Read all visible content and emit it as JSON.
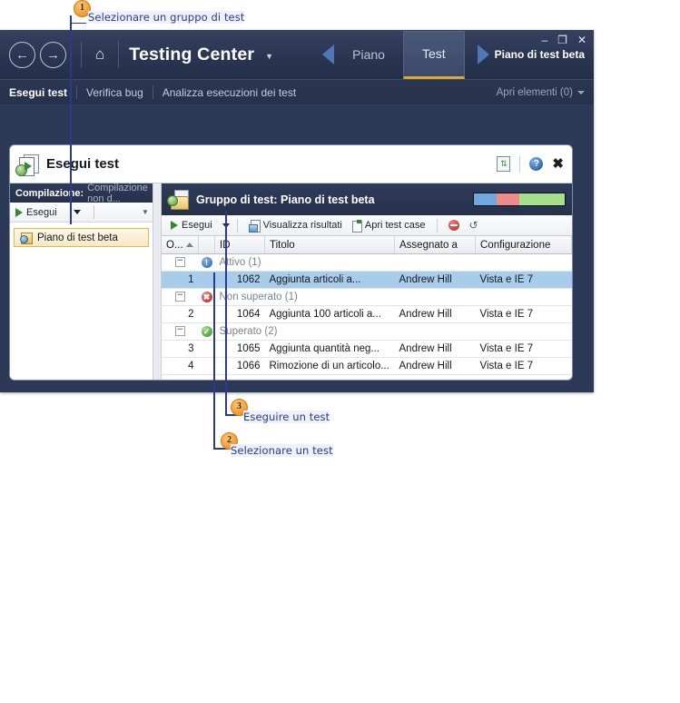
{
  "annotations": [
    {
      "num": "1",
      "text": "Selezionare un gruppo di test"
    },
    {
      "num": "2",
      "text": "Selezionare un test"
    },
    {
      "num": "3",
      "text": "Eseguire un test"
    }
  ],
  "titlebar": {
    "back_icon": "back-arrow-icon",
    "forward_icon": "forward-arrow-icon",
    "home_icon": "home-icon",
    "app_title": "Testing Center",
    "title_caret": "▼",
    "breadcrumb_prev": "Piano",
    "breadcrumb_active": "Test",
    "breadcrumb_current": "Piano di test beta",
    "minimize": "–",
    "maximize": "❐",
    "close": "✕"
  },
  "menubar": {
    "items": [
      {
        "label": "Esegui test",
        "active": true
      },
      {
        "label": "Verifica bug",
        "active": false
      },
      {
        "label": "Analizza esecuzioni dei test",
        "active": false
      }
    ],
    "right_label": "Apri elementi (0)"
  },
  "panel": {
    "title": "Esegui test",
    "icon": "run-tests-icon",
    "refresh_icon": "refresh-icon",
    "help_icon": "help-icon",
    "close_icon": "close-icon"
  },
  "left_pane": {
    "header_label": "Compilazione:",
    "header_value": "Compilazione non d...",
    "toolbar": {
      "run_label": "Esegui",
      "run_icon": "play-icon",
      "dropdown_icon": "chevron-down-icon"
    },
    "items": [
      {
        "label": "Piano di test beta",
        "icon": "test-plan-icon",
        "selected": true
      }
    ]
  },
  "right_pane": {
    "group_title": "Gruppo di test: Piano di test beta",
    "group_icon": "test-suite-icon",
    "progress": {
      "segments": [
        {
          "name": "active",
          "color": "#6fa8e0",
          "percent": 25
        },
        {
          "name": "failed",
          "color": "#ee8c8c",
          "percent": 25
        },
        {
          "name": "passed",
          "color": "#a6e08a",
          "percent": 50
        }
      ]
    },
    "toolbar": [
      {
        "label": "Esegui",
        "icon": "play-icon",
        "caret": true
      },
      {
        "label": "Visualizza risultati",
        "icon": "view-results-icon",
        "caret": false
      },
      {
        "label": "Apri test case",
        "icon": "open-test-case-icon",
        "caret": false
      },
      {
        "label": "",
        "icon": "block-icon",
        "caret": false
      },
      {
        "label": "",
        "icon": "reset-icon",
        "caret": false
      }
    ],
    "table": {
      "columns": [
        "O...",
        "",
        "ID",
        "Titolo",
        "Assegnato a",
        "Configurazione"
      ],
      "sort_column": "O...",
      "sort_direction": "asc",
      "groups": [
        {
          "status": "Attivo",
          "status_icon": "info-icon",
          "count": "(1)",
          "rows": [
            {
              "order": "1",
              "id": "1062",
              "titolo": "Aggiunta articoli a...",
              "assegnato": "Andrew Hill",
              "configurazione": "Vista e IE 7",
              "selected": true
            }
          ]
        },
        {
          "status": "Non superato",
          "status_icon": "fail-icon",
          "count": "(1)",
          "rows": [
            {
              "order": "2",
              "id": "1064",
              "titolo": "Aggiunta 100 articoli a...",
              "assegnato": "Andrew Hill",
              "configurazione": "Vista e IE 7",
              "selected": false
            }
          ]
        },
        {
          "status": "Superato",
          "status_icon": "pass-icon",
          "count": "(2)",
          "rows": [
            {
              "order": "3",
              "id": "1065",
              "titolo": "Aggiunta quantità neg...",
              "assegnato": "Andrew Hill",
              "configurazione": "Vista e IE 7",
              "selected": false
            },
            {
              "order": "4",
              "id": "1066",
              "titolo": "Rimozione di un articolo...",
              "assegnato": "Andrew Hill",
              "configurazione": "Vista e IE 7",
              "selected": false
            }
          ]
        }
      ]
    }
  },
  "colors": {
    "chrome_dark": "#2b3753",
    "accent_gold": "#dfa82b",
    "selection_blue": "#a8cdea",
    "annotation_blue": "#2b3a8f",
    "badge_orange": "#f3a33c"
  }
}
